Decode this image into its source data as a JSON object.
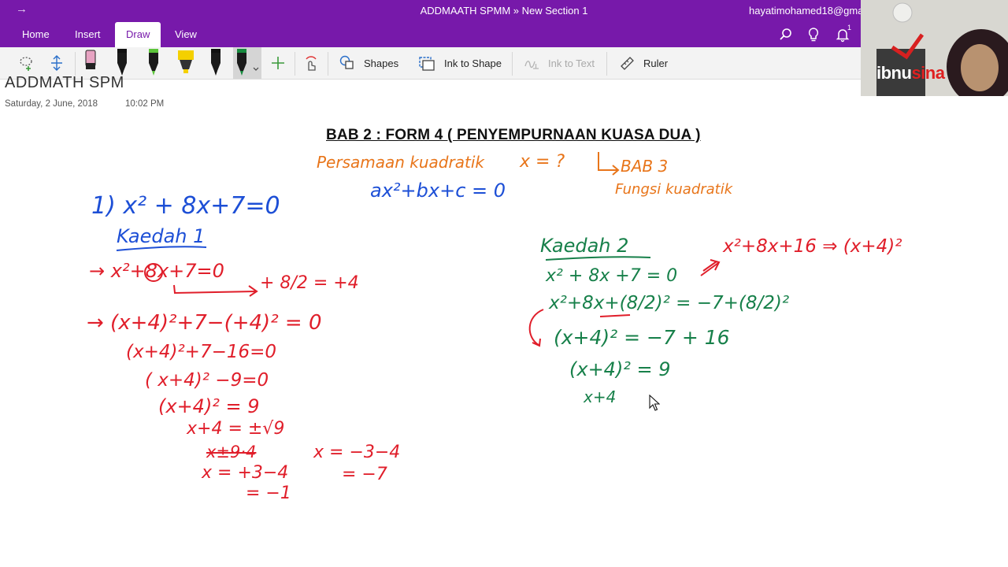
{
  "window": {
    "title": "ADDMAATH SPMM » New Section 1",
    "user": "hayatimohamed18@gma"
  },
  "tabs": [
    {
      "label": "Home"
    },
    {
      "label": "Insert"
    },
    {
      "label": "Draw",
      "active": true
    },
    {
      "label": "View"
    }
  ],
  "title_icons": [
    "search-icon",
    "lightbulb-icon",
    "bell-icon"
  ],
  "notification_count": "1",
  "ribbon": {
    "shapes_label": "Shapes",
    "ink_to_shape_label": "Ink to Shape",
    "ink_to_text_label": "Ink to Text",
    "ruler_label": "Ruler",
    "pens": [
      {
        "name": "eraser",
        "color": "#e7a3c2"
      },
      {
        "name": "black-pen-1",
        "color": "#111111"
      },
      {
        "name": "green-pen-1",
        "color": "#5cc43a"
      },
      {
        "name": "yellow-highlighter",
        "color": "#f4d000"
      },
      {
        "name": "black-pen-2",
        "color": "#111111"
      },
      {
        "name": "green-pen-selected",
        "color": "#168a3e"
      }
    ]
  },
  "page": {
    "title": "ADDMATH SPM",
    "date": "Saturday, 2 June, 2018",
    "time": "10:02 PM",
    "heading": "BAB 2 : FORM 4 ( PENYEMPURNAAN KUASA DUA )"
  },
  "ink_colors": {
    "blue": "#1d4fd6",
    "red": "#e01e2a",
    "green": "#17804a",
    "orange": "#e8751a"
  },
  "ink": {
    "top_left": "Persamaan kuadratik",
    "top_x": "x = ?",
    "bab3": "BAB 3",
    "fungsi": "Fungsi kuadratik",
    "general_form": "ax²+bx+c = 0",
    "problem": "1) x² + 8x+7=0",
    "kaedah1": "Kaedah 1",
    "step_a": "→ x²+8x+7=0",
    "half_coef": "+ 8/2 = +4",
    "step_b": "→ (x+4)²+7−(+4)² = 0",
    "step_c": "(x+4)²+7−16=0",
    "step_d": "( x+4)² −9=0",
    "step_e": "(x+4)² = 9",
    "step_f": "x+4 = ±√9",
    "step_g": "x±9·4",
    "step_h": "x = +3−4",
    "step_i": "= −1",
    "step_j": "x = −3−4",
    "step_k": "= −7",
    "kaedah2": "Kaedah 2",
    "k2_expand": "x²+8x+16 ⇒ (x+4)²",
    "k2_step1": "x² + 8x +7 = 0",
    "k2_step2": "x²+8x+(8/2)² = −7+(8/2)²",
    "k2_step3": "(x+4)² = −7 + 16",
    "k2_step4": "(x+4)² = 9",
    "k2_step5": "x+4"
  },
  "webcam": {
    "logo_a": "ibnu",
    "logo_b": "sina"
  }
}
